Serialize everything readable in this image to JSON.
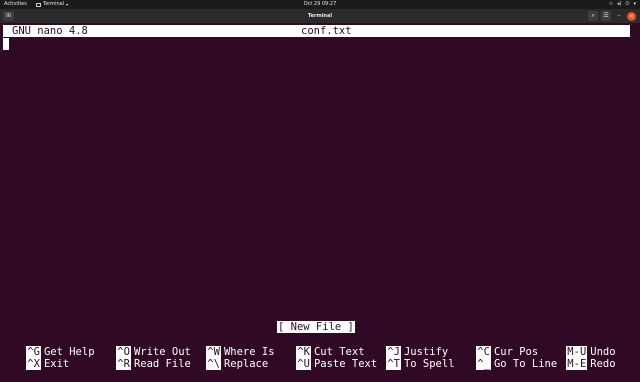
{
  "topbar": {
    "activities": "Activities",
    "app_name": "Terminal",
    "clock": "Oct 29  09:27",
    "icons": [
      "network-icon",
      "volume-muted-icon",
      "power-icon",
      "chevron-down-icon"
    ]
  },
  "window": {
    "title": "Terminal",
    "buttons": [
      "new-tab-icon",
      "search-icon",
      "menu-icon",
      "minimize-icon",
      "close-icon"
    ]
  },
  "nano": {
    "version": "GNU nano 4.8",
    "filename": "conf.txt",
    "status": "[ New File ]",
    "shortcuts_row1": [
      {
        "key": "^G",
        "label": "Get Help"
      },
      {
        "key": "^O",
        "label": "Write Out"
      },
      {
        "key": "^W",
        "label": "Where Is"
      },
      {
        "key": "^K",
        "label": "Cut Text"
      },
      {
        "key": "^J",
        "label": "Justify"
      },
      {
        "key": "^C",
        "label": "Cur Pos"
      },
      {
        "key": "M-U",
        "label": "Undo"
      }
    ],
    "shortcuts_row2": [
      {
        "key": "^X",
        "label": "Exit"
      },
      {
        "key": "^R",
        "label": "Read File"
      },
      {
        "key": "^\\",
        "label": "Replace"
      },
      {
        "key": "^U",
        "label": "Paste Text"
      },
      {
        "key": "^T",
        "label": "To Spell"
      },
      {
        "key": "^_",
        "label": "Go To Line"
      },
      {
        "key": "M-E",
        "label": "Redo"
      }
    ]
  },
  "colors": {
    "terminal_bg": "#300a24",
    "accent_close": "#e95420"
  }
}
